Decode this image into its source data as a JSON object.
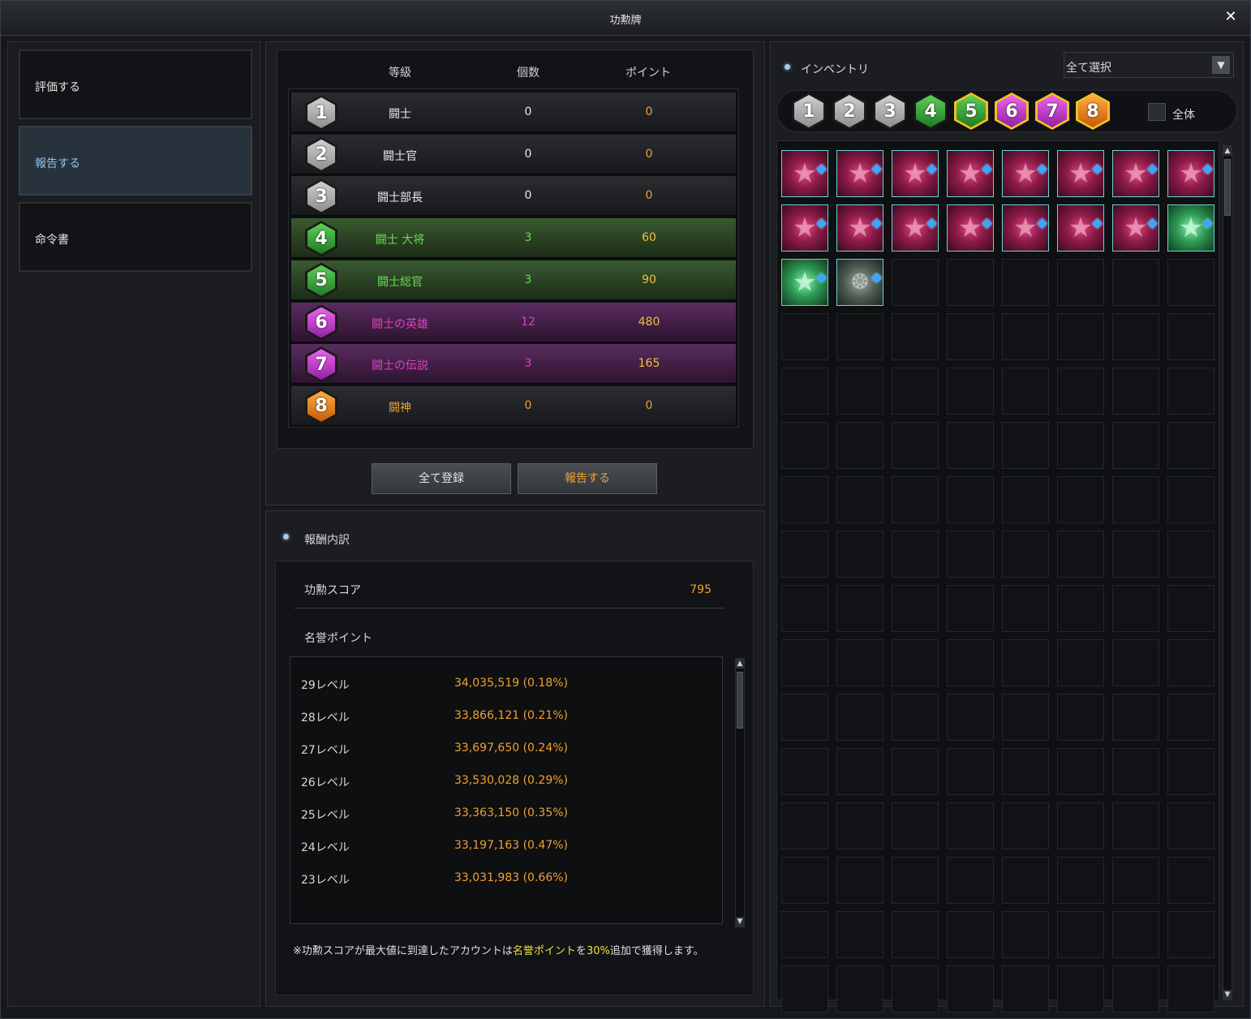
{
  "window": {
    "title": "功勲牌",
    "close_icon": "close-icon"
  },
  "nav": {
    "items": [
      {
        "label": "評価する",
        "active": false
      },
      {
        "label": "報告する",
        "active": true
      },
      {
        "label": "命令書",
        "active": false
      }
    ]
  },
  "grade_table": {
    "headers": {
      "grade": "等級",
      "count": "個数",
      "points": "ポイント"
    },
    "rows": [
      {
        "level": "1",
        "name": "闘士",
        "count": "0",
        "points": "0",
        "color": "#e8e8e8"
      },
      {
        "level": "2",
        "name": "闘士官",
        "count": "0",
        "points": "0",
        "color": "#e8e8e8"
      },
      {
        "level": "3",
        "name": "闘士部長",
        "count": "0",
        "points": "0",
        "color": "#e8e8e8"
      },
      {
        "level": "4",
        "name": "闘士 大将",
        "count": "3",
        "points": "60",
        "color": "#66dd55"
      },
      {
        "level": "5",
        "name": "闘士総官",
        "count": "3",
        "points": "90",
        "color": "#66dd55"
      },
      {
        "level": "6",
        "name": "闘士の英雄",
        "count": "12",
        "points": "480",
        "color": "#e040c0"
      },
      {
        "level": "7",
        "name": "闘士の伝説",
        "count": "3",
        "points": "165",
        "color": "#e040c0"
      },
      {
        "level": "8",
        "name": "闘神",
        "count": "0",
        "points": "0",
        "color": "#f0a030"
      }
    ]
  },
  "actions": {
    "register_all": "全て登録",
    "report": "報告する"
  },
  "reward": {
    "section_title": "報酬内訳",
    "score_label": "功勲スコア",
    "score_value": "795",
    "honor_label": "名誉ポイント",
    "levels": [
      {
        "level": "29レベル",
        "value": "34,035,519 (0.18%)"
      },
      {
        "level": "28レベル",
        "value": "33,866,121 (0.21%)"
      },
      {
        "level": "27レベル",
        "value": "33,697,650 (0.24%)"
      },
      {
        "level": "26レベル",
        "value": "33,530,028 (0.29%)"
      },
      {
        "level": "25レベル",
        "value": "33,363,150 (0.35%)"
      },
      {
        "level": "24レベル",
        "value": "33,197,163 (0.47%)"
      },
      {
        "level": "23レベル",
        "value": "33,031,983 (0.66%)"
      }
    ],
    "note_parts": {
      "a": "※功勲スコアが最大値に到達したアカウントは",
      "b": "名誉ポイント",
      "c": "を",
      "d": "30%",
      "e": "追加で獲得します。"
    }
  },
  "inventory": {
    "title": "インベントリ",
    "select_value": "全て選択",
    "filter_all_label": "全体",
    "filters": [
      "1",
      "2",
      "3",
      "4",
      "5",
      "6",
      "7",
      "8"
    ],
    "items": [
      "red",
      "red",
      "red",
      "red",
      "red",
      "red",
      "red",
      "red",
      "red",
      "red",
      "red",
      "red",
      "red",
      "red",
      "red",
      "green",
      "green",
      "gray"
    ]
  },
  "colors": {
    "accent_orange": "#f0a030",
    "green_text": "#66dd55",
    "purple_text": "#e040c0",
    "nav_active": "#8fc0ee"
  }
}
